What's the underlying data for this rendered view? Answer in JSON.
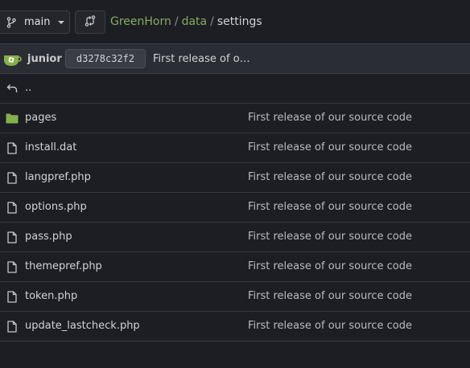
{
  "header": {
    "branch_label": "main",
    "branch_icon": "git-branch-icon",
    "compare_icon": "git-compare-icon",
    "breadcrumb": {
      "repo": "GreenHorn",
      "folder": "data",
      "current": "settings",
      "separator": "/"
    }
  },
  "commit": {
    "author": "junior",
    "sha": "d3278c32f2",
    "message": "First release of o…"
  },
  "files": {
    "parent": {
      "name": "..",
      "icon": "back-arrow-icon"
    },
    "items": [
      {
        "name": "pages",
        "type": "folder",
        "message": "First release of our source code"
      },
      {
        "name": "install.dat",
        "type": "file",
        "message": "First release of our source code"
      },
      {
        "name": "langpref.php",
        "type": "file",
        "message": "First release of our source code"
      },
      {
        "name": "options.php",
        "type": "file",
        "message": "First release of our source code"
      },
      {
        "name": "pass.php",
        "type": "file",
        "message": "First release of our source code"
      },
      {
        "name": "themepref.php",
        "type": "file",
        "message": "First release of our source code"
      },
      {
        "name": "token.php",
        "type": "file",
        "message": "First release of our source code"
      },
      {
        "name": "update_lastcheck.php",
        "type": "file",
        "message": "First release of our source code"
      }
    ]
  },
  "colors": {
    "link": "#87ab63",
    "folder": "#86b04a",
    "background": "#1c1e23",
    "commit_bar": "#2a2d33"
  }
}
